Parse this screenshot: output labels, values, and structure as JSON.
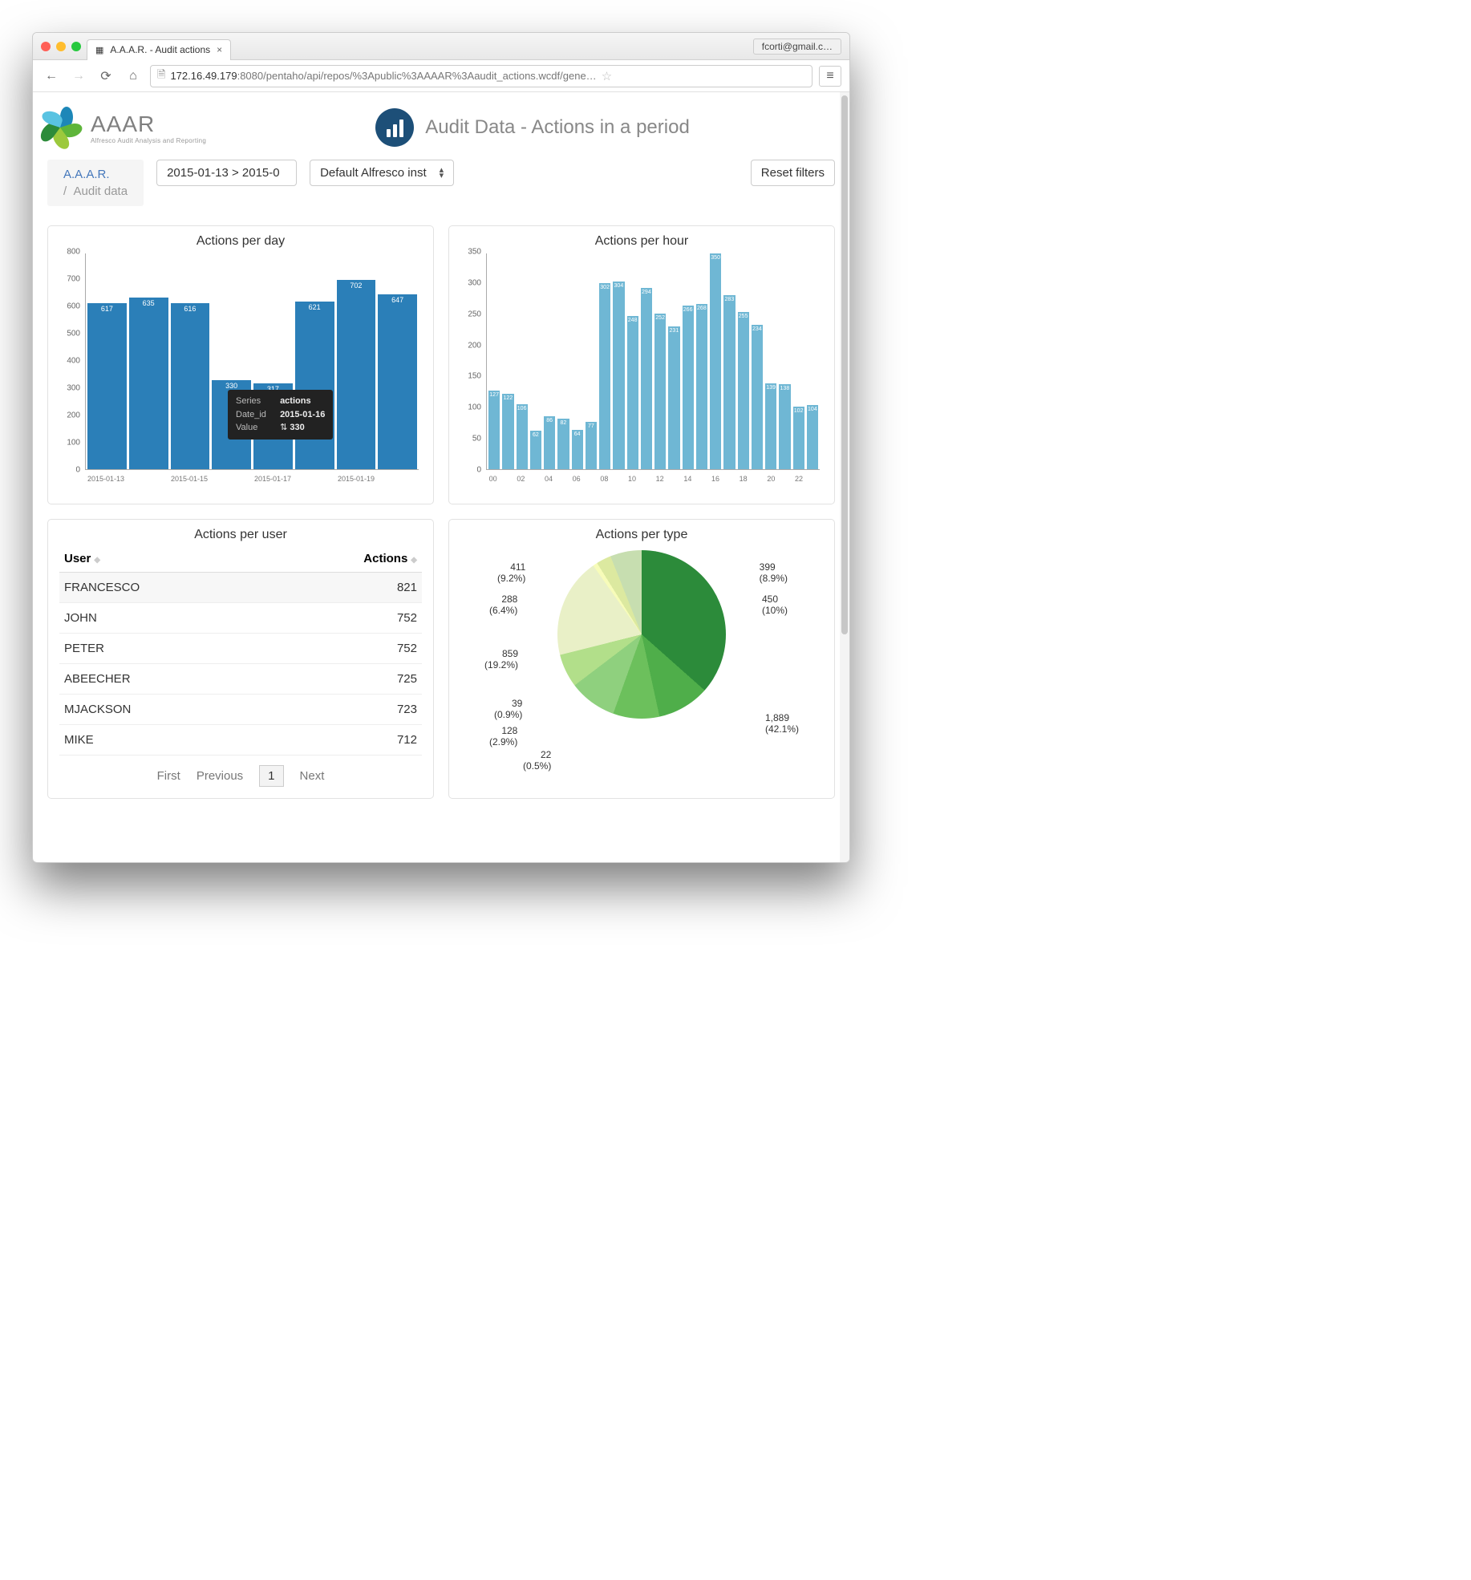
{
  "browser": {
    "tab_title": "A.A.A.R. - Audit actions",
    "user": "fcorti@gmail.c…",
    "url_host": "172.16.49.179",
    "url_port": ":8080",
    "url_path": "/pentaho/api/repos/%3Apublic%3AAAAR%3Aaudit_actions.wcdf/gene…"
  },
  "header": {
    "logo_main": "AAAR",
    "logo_sub": "Alfresco Audit Analysis and Reporting",
    "title": "Audit Data - Actions in a period"
  },
  "breadcrumb": {
    "top": "A.A.A.R.",
    "sep": "/",
    "sub": "Audit data"
  },
  "controls": {
    "date_range": "2015-01-13 > 2015-0",
    "instance": "Default Alfresco inst",
    "reset": "Reset filters"
  },
  "tooltip": {
    "series_k": "Series",
    "series_v": "actions",
    "date_k": "Date_id",
    "date_v": "2015-01-16",
    "value_k": "Value",
    "value_v": "330"
  },
  "chart_titles": {
    "day": "Actions per day",
    "hour": "Actions per hour",
    "user": "Actions per user",
    "type": "Actions per type"
  },
  "table": {
    "col_user": "User",
    "col_actions": "Actions",
    "rows": [
      {
        "user": "FRANCESCO",
        "actions": "821"
      },
      {
        "user": "JOHN",
        "actions": "752"
      },
      {
        "user": "PETER",
        "actions": "752"
      },
      {
        "user": "ABEECHER",
        "actions": "725"
      },
      {
        "user": "MJACKSON",
        "actions": "723"
      },
      {
        "user": "MIKE",
        "actions": "712"
      }
    ],
    "first": "First",
    "prev": "Previous",
    "page": "1",
    "next": "Next"
  },
  "chart_data": [
    {
      "id": "actions_per_day",
      "type": "bar",
      "title": "Actions per day",
      "ylim": [
        0,
        800
      ],
      "yticks": [
        0,
        100,
        200,
        300,
        400,
        500,
        600,
        700,
        800
      ],
      "categories": [
        "2015-01-13",
        "2015-01-14",
        "2015-01-15",
        "2015-01-16",
        "2015-01-17",
        "2015-01-18",
        "2015-01-19",
        "2015-01-20"
      ],
      "xticks": [
        "2015-01-13",
        "2015-01-15",
        "2015-01-17",
        "2015-01-19"
      ],
      "values": [
        617,
        635,
        616,
        330,
        317,
        621,
        702,
        647
      ],
      "color": "#2b7fb8"
    },
    {
      "id": "actions_per_hour",
      "type": "bar",
      "title": "Actions per hour",
      "ylim": [
        0,
        350
      ],
      "yticks": [
        0,
        50,
        100,
        150,
        200,
        250,
        300,
        350
      ],
      "categories": [
        "00",
        "01",
        "02",
        "03",
        "04",
        "05",
        "06",
        "07",
        "08",
        "09",
        "10",
        "11",
        "12",
        "13",
        "14",
        "15",
        "16",
        "17",
        "18",
        "19",
        "20",
        "21",
        "22",
        "23"
      ],
      "xticks": [
        "00",
        "02",
        "04",
        "06",
        "08",
        "10",
        "12",
        "14",
        "16",
        "18",
        "20",
        "22"
      ],
      "values": [
        127,
        122,
        106,
        62,
        86,
        82,
        64,
        77,
        302,
        304,
        248,
        294,
        252,
        231,
        266,
        268,
        350,
        283,
        255,
        234,
        139,
        138,
        102,
        104
      ],
      "color": "#6fb7d4"
    },
    {
      "id": "actions_per_type",
      "type": "pie",
      "title": "Actions per type",
      "series": [
        {
          "value": 1889,
          "pct": "42.1%",
          "color": "#2c8b3a"
        },
        {
          "value": 450,
          "pct": "10%",
          "color": "#4fae4a"
        },
        {
          "value": 399,
          "pct": "8.9%",
          "color": "#6cc05c"
        },
        {
          "value": 411,
          "pct": "9.2%",
          "color": "#8fd07e"
        },
        {
          "value": 288,
          "pct": "6.4%",
          "color": "#b2df8a"
        },
        {
          "value": 859,
          "pct": "19.2%",
          "color": "#e9f0c7"
        },
        {
          "value": 39,
          "pct": "0.9%",
          "color": "#f7fcb9"
        },
        {
          "value": 128,
          "pct": "2.9%",
          "color": "#dce9a0"
        },
        {
          "value": 22,
          "pct": "0.5%",
          "color": "#c7deb0"
        }
      ]
    }
  ],
  "pie_labels": {
    "a": "411",
    "ap": "(9.2%)",
    "b": "288",
    "bp": "(6.4%)",
    "c": "859",
    "cp": "(19.2%)",
    "d": "39",
    "dp": "(0.9%)",
    "e": "128",
    "ep": "(2.9%)",
    "f": "22",
    "fp": "(0.5%)",
    "g": "399",
    "gp": "(8.9%)",
    "h": "450",
    "hp": "(10%)",
    "i": "1,889",
    "ip": "(42.1%)"
  }
}
